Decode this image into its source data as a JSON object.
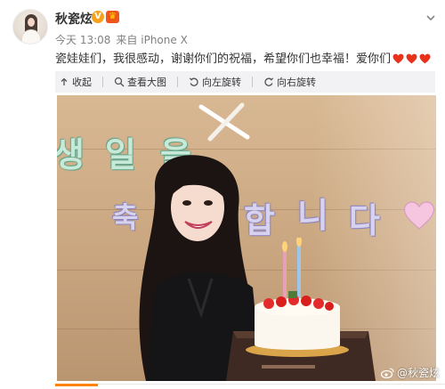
{
  "user": {
    "nickname": "秋瓷炫",
    "verified_badge": "V",
    "member_badge": "♛"
  },
  "meta": {
    "time": "今天 13:08",
    "from_label": "来自",
    "device": "iPhone X"
  },
  "post": {
    "text": "瓷娃娃们，我很感动，谢谢你们的祝福，希望你们也幸福！爱你们",
    "heart_icons": [
      "heart-icon",
      "heart-icon",
      "heart-icon"
    ]
  },
  "toolbar": {
    "collapse_label": "收起",
    "view_large_label": "查看大图",
    "rotate_left_label": "向左旋转",
    "rotate_right_label": "向右旋转"
  },
  "photo": {
    "banner_row1": [
      "생",
      "일",
      "을"
    ],
    "banner_row2": [
      "축",
      "합",
      "니",
      "다"
    ],
    "watermark": "@秋瓷炫"
  },
  "colors": {
    "accent": "#ff8200",
    "heart": "#e8311a",
    "toolbar_bg": "#f2f2f5",
    "verified": "#f7a21a",
    "member": "#f0551c"
  }
}
